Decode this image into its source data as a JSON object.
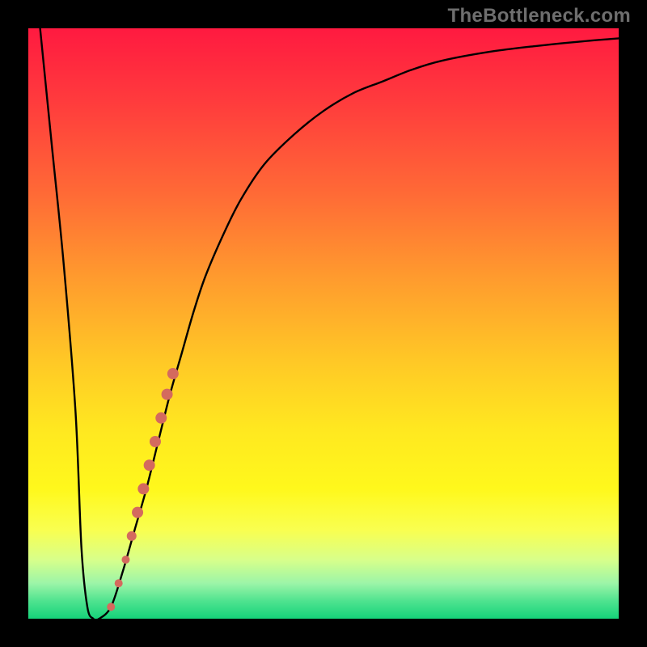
{
  "watermark": "TheBottleneck.com",
  "colors": {
    "curve_stroke": "#000000",
    "marker_fill": "#d46a5e",
    "gradient_top": "#ff1a40",
    "gradient_bottom": "#15d37a",
    "frame": "#000000"
  },
  "chart_data": {
    "type": "line",
    "title": "",
    "xlabel": "",
    "ylabel": "",
    "xlim": [
      0,
      100
    ],
    "ylim": [
      0,
      100
    ],
    "grid": false,
    "series": [
      {
        "name": "bottleneck-curve",
        "x": [
          2,
          4,
          6,
          8,
          9,
          10,
          11,
          12,
          14,
          16,
          18,
          20,
          22,
          24,
          26,
          28,
          30,
          33,
          36,
          40,
          45,
          50,
          55,
          60,
          65,
          70,
          78,
          86,
          94,
          100
        ],
        "y": [
          100,
          80,
          60,
          35,
          12,
          2,
          0,
          0,
          2,
          8,
          15,
          22,
          30,
          38,
          45,
          52,
          58,
          65,
          71,
          77,
          82,
          86,
          89,
          91,
          93,
          94.5,
          96,
          97,
          97.8,
          98.3
        ]
      }
    ],
    "markers": {
      "series": "bottleneck-curve",
      "shape": "circle",
      "color": "#d46a5e",
      "points": [
        {
          "x": 14.0,
          "y": 2.0,
          "r": 5
        },
        {
          "x": 15.3,
          "y": 6.0,
          "r": 5
        },
        {
          "x": 16.5,
          "y": 10.0,
          "r": 5
        },
        {
          "x": 17.5,
          "y": 14.0,
          "r": 6
        },
        {
          "x": 18.5,
          "y": 18.0,
          "r": 7
        },
        {
          "x": 19.5,
          "y": 22.0,
          "r": 7
        },
        {
          "x": 20.5,
          "y": 26.0,
          "r": 7
        },
        {
          "x": 21.5,
          "y": 30.0,
          "r": 7
        },
        {
          "x": 22.5,
          "y": 34.0,
          "r": 7
        },
        {
          "x": 23.5,
          "y": 38.0,
          "r": 7
        },
        {
          "x": 24.5,
          "y": 41.5,
          "r": 7
        }
      ]
    }
  }
}
